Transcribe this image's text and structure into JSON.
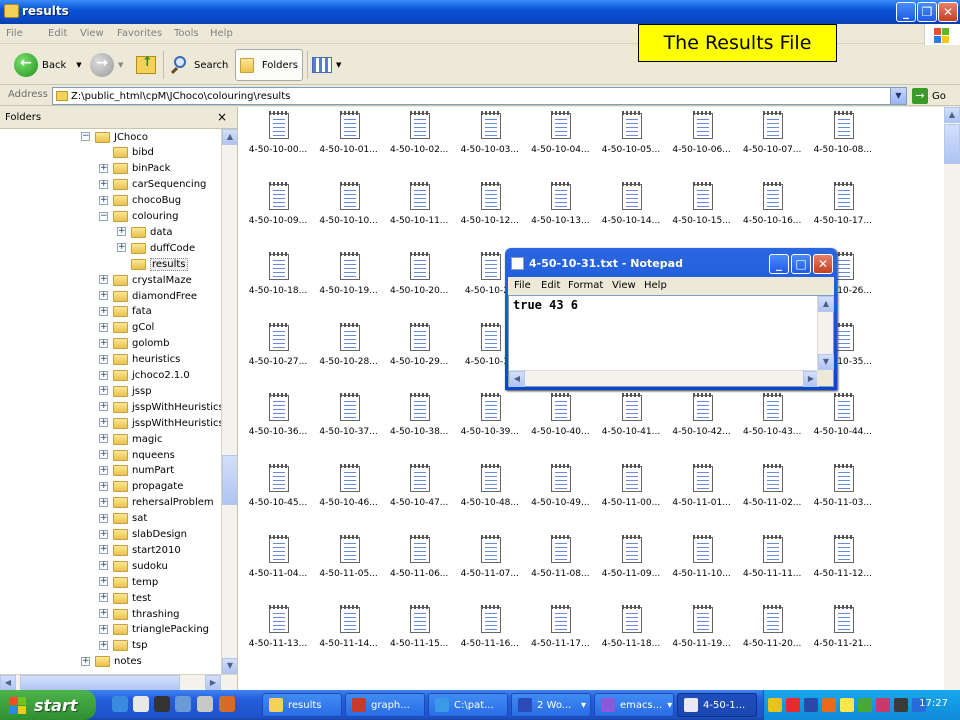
{
  "window": {
    "title": "results"
  },
  "menu": [
    "File",
    "Edit",
    "View",
    "Favorites",
    "Tools",
    "Help"
  ],
  "toolbar": {
    "back": "Back",
    "search": "Search",
    "folders": "Folders"
  },
  "address": {
    "label": "Address",
    "path": "Z:\\public_html\\cpM\\JChoco\\colouring\\results",
    "go": "Go"
  },
  "folders_panel": {
    "title": "Folders",
    "close": "×"
  },
  "tree": [
    {
      "label": "JChoco",
      "level": 0,
      "state": "expanded"
    },
    {
      "label": "bibd",
      "level": 1,
      "state": "none"
    },
    {
      "label": "binPack",
      "level": 1,
      "state": "collapsed"
    },
    {
      "label": "carSequencing",
      "level": 1,
      "state": "collapsed"
    },
    {
      "label": "chocoBug",
      "level": 1,
      "state": "collapsed"
    },
    {
      "label": "colouring",
      "level": 1,
      "state": "expanded"
    },
    {
      "label": "data",
      "level": 2,
      "state": "collapsed"
    },
    {
      "label": "duffCode",
      "level": 2,
      "state": "collapsed"
    },
    {
      "label": "results",
      "level": 2,
      "state": "none",
      "selected": true
    },
    {
      "label": "crystalMaze",
      "level": 1,
      "state": "collapsed"
    },
    {
      "label": "diamondFree",
      "level": 1,
      "state": "collapsed"
    },
    {
      "label": "fata",
      "level": 1,
      "state": "collapsed"
    },
    {
      "label": "gCol",
      "level": 1,
      "state": "collapsed"
    },
    {
      "label": "golomb",
      "level": 1,
      "state": "collapsed"
    },
    {
      "label": "heuristics",
      "level": 1,
      "state": "collapsed"
    },
    {
      "label": "jchoco2.1.0",
      "level": 1,
      "state": "collapsed"
    },
    {
      "label": "jssp",
      "level": 1,
      "state": "collapsed"
    },
    {
      "label": "jsspWithHeuristics",
      "level": 1,
      "state": "collapsed"
    },
    {
      "label": "jsspWithHeuristicsOl",
      "level": 1,
      "state": "collapsed"
    },
    {
      "label": "magic",
      "level": 1,
      "state": "collapsed"
    },
    {
      "label": "nqueens",
      "level": 1,
      "state": "collapsed"
    },
    {
      "label": "numPart",
      "level": 1,
      "state": "collapsed"
    },
    {
      "label": "propagate",
      "level": 1,
      "state": "collapsed"
    },
    {
      "label": "rehersalProblem",
      "level": 1,
      "state": "collapsed"
    },
    {
      "label": "sat",
      "level": 1,
      "state": "collapsed"
    },
    {
      "label": "slabDesign",
      "level": 1,
      "state": "collapsed"
    },
    {
      "label": "start2010",
      "level": 1,
      "state": "collapsed"
    },
    {
      "label": "sudoku",
      "level": 1,
      "state": "collapsed"
    },
    {
      "label": "temp",
      "level": 1,
      "state": "collapsed"
    },
    {
      "label": "test",
      "level": 1,
      "state": "collapsed"
    },
    {
      "label": "thrashing",
      "level": 1,
      "state": "collapsed"
    },
    {
      "label": "trianglePacking",
      "level": 1,
      "state": "collapsed"
    },
    {
      "label": "tsp",
      "level": 1,
      "state": "collapsed"
    },
    {
      "label": "notes",
      "level": 0,
      "state": "collapsed"
    }
  ],
  "files": [
    [
      "4-50-10-00...",
      "4-50-10-01...",
      "4-50-10-02...",
      "4-50-10-03...",
      "4-50-10-04...",
      "4-50-10-05...",
      "4-50-10-06...",
      "4-50-10-07...",
      "4-50-10-08..."
    ],
    [
      "4-50-10-09...",
      "4-50-10-10...",
      "4-50-10-11...",
      "4-50-10-12...",
      "4-50-10-13...",
      "4-50-10-14...",
      "4-50-10-15...",
      "4-50-10-16...",
      "4-50-10-17..."
    ],
    [
      "4-50-10-18...",
      "4-50-10-19...",
      "4-50-10-20...",
      "4-50-10-21",
      "",
      "",
      "",
      "",
      "4-50-10-26..."
    ],
    [
      "4-50-10-27...",
      "4-50-10-28...",
      "4-50-10-29...",
      "4-50-10-30",
      "",
      "",
      "",
      "",
      "4-50-10-35..."
    ],
    [
      "4-50-10-36...",
      "4-50-10-37...",
      "4-50-10-38...",
      "4-50-10-39...",
      "4-50-10-40...",
      "4-50-10-41...",
      "4-50-10-42...",
      "4-50-10-43...",
      "4-50-10-44..."
    ],
    [
      "4-50-10-45...",
      "4-50-10-46...",
      "4-50-10-47...",
      "4-50-10-48...",
      "4-50-10-49...",
      "4-50-11-00...",
      "4-50-11-01...",
      "4-50-11-02...",
      "4-50-11-03..."
    ],
    [
      "4-50-11-04...",
      "4-50-11-05...",
      "4-50-11-06...",
      "4-50-11-07...",
      "4-50-11-08...",
      "4-50-11-09...",
      "4-50-11-10...",
      "4-50-11-11...",
      "4-50-11-12..."
    ],
    [
      "4-50-11-13...",
      "4-50-11-14...",
      "4-50-11-15...",
      "4-50-11-16...",
      "4-50-11-17...",
      "4-50-11-18...",
      "4-50-11-19...",
      "4-50-11-20...",
      "4-50-11-21..."
    ]
  ],
  "callout": "The Results File",
  "notepad": {
    "title": "4-50-10-31.txt - Notepad",
    "menu": [
      "File",
      "Edit",
      "Format",
      "View",
      "Help"
    ],
    "content": "true 43 6"
  },
  "taskbar": {
    "start": "start",
    "buttons": [
      {
        "label": "results",
        "icon": "folder-icon"
      },
      {
        "label": "graph...",
        "icon": "graph-app-icon"
      },
      {
        "label": "C:\\pat...",
        "icon": "ie-icon"
      },
      {
        "label": "2 Wo...",
        "icon": "word-icon"
      },
      {
        "label": "emacs...",
        "icon": "emacs-icon"
      },
      {
        "label": "4-50-1...",
        "icon": "notepad-icon"
      }
    ],
    "clock": "17:27"
  },
  "colors": {
    "titlebar": "#0a54d6",
    "callout_bg": "#ffff00",
    "taskbar": "#245edb",
    "start": "#3a9a36",
    "tray": "#0f8ad8"
  }
}
